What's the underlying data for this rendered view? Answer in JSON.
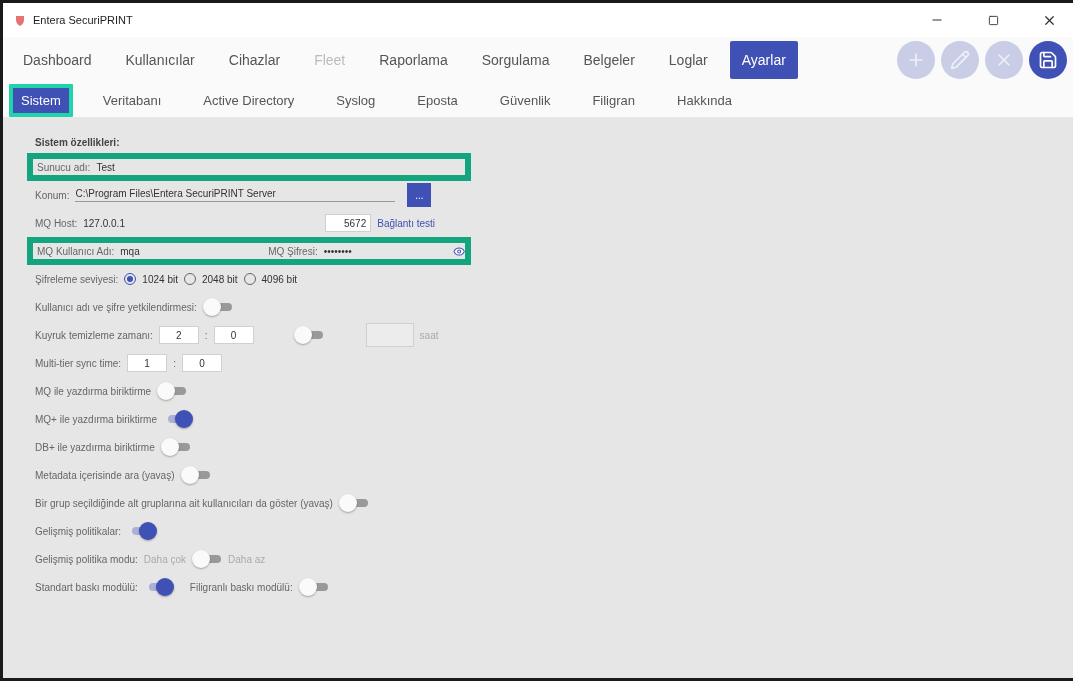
{
  "window": {
    "title": "Entera SecuriPRINT"
  },
  "nav": [
    {
      "label": "Dashboard",
      "selected": false,
      "disabled": false
    },
    {
      "label": "Kullanıcılar",
      "selected": false,
      "disabled": false
    },
    {
      "label": "Cihazlar",
      "selected": false,
      "disabled": false
    },
    {
      "label": "Fleet",
      "selected": false,
      "disabled": true
    },
    {
      "label": "Raporlama",
      "selected": false,
      "disabled": false
    },
    {
      "label": "Sorgulama",
      "selected": false,
      "disabled": false
    },
    {
      "label": "Belgeler",
      "selected": false,
      "disabled": false
    },
    {
      "label": "Loglar",
      "selected": false,
      "disabled": false
    },
    {
      "label": "Ayarlar",
      "selected": true,
      "disabled": false
    }
  ],
  "toolbar": [
    {
      "kind": "add",
      "disabled": true
    },
    {
      "kind": "edit",
      "disabled": true
    },
    {
      "kind": "delete",
      "disabled": true
    },
    {
      "kind": "save",
      "disabled": false
    }
  ],
  "sub_tabs": [
    {
      "label": "Sistem",
      "selected": true,
      "highlighted": true
    },
    {
      "label": "Veritabanı",
      "selected": false,
      "highlighted": false
    },
    {
      "label": "Active Directory",
      "selected": false,
      "highlighted": false
    },
    {
      "label": "Syslog",
      "selected": false,
      "highlighted": false
    },
    {
      "label": "Eposta",
      "selected": false,
      "highlighted": false
    },
    {
      "label": "Güvenlik",
      "selected": false,
      "highlighted": false
    },
    {
      "label": "Filigran",
      "selected": false,
      "highlighted": false
    },
    {
      "label": "Hakkında",
      "selected": false,
      "highlighted": false
    }
  ],
  "section_title": "Sistem özellikleri:",
  "rows": [
    {
      "kind": "text",
      "label": "Sunucu adı:",
      "value": "Test",
      "highlighted": true
    },
    {
      "kind": "path",
      "label": "Konum:",
      "value": "C:\\Program Files\\Entera SecuriPRINT Server",
      "button": "...",
      "highlighted": false
    },
    {
      "kind": "host",
      "label": "MQ Host:",
      "value": "127.0.0.1",
      "port": "5672",
      "link": "Bağlantı testi",
      "highlighted": false
    },
    {
      "kind": "credentials",
      "user_label": "MQ Kullanıcı Adı:",
      "user_value": "mqa",
      "password_label": "MQ Şifresi:",
      "password_value": "••••••••",
      "highlighted": true
    },
    {
      "kind": "radio",
      "label": "Şifreleme seviyesi:",
      "options": [
        {
          "label": "1024 bit",
          "selected": true
        },
        {
          "label": "2048 bit",
          "selected": false
        },
        {
          "label": "4096 bit",
          "selected": false
        }
      ]
    },
    {
      "kind": "toggle",
      "label": "Kullanıcı adı ve şifre yetkilendirmesi:",
      "on": false
    },
    {
      "kind": "time_toggle",
      "label": "Kuyruk temizleme zamanı:",
      "hours": "2",
      "separator": ":",
      "minutes": "0",
      "on": false,
      "unit": "saat"
    },
    {
      "kind": "time",
      "label": "Multi-tier sync time:",
      "hours": "1",
      "separator": ":",
      "minutes": "0"
    },
    {
      "kind": "toggle",
      "label": "MQ ile yazdırma biriktirme",
      "on": false
    },
    {
      "kind": "toggle",
      "label": "MQ+ ile yazdırma biriktirme",
      "on": true
    },
    {
      "kind": "toggle",
      "label": "DB+ ile yazdırma biriktirme",
      "on": false
    },
    {
      "kind": "toggle",
      "label": "Metadata içerisinde ara (yavaş)",
      "on": false
    },
    {
      "kind": "toggle",
      "label": "Bir grup seçildiğinde alt gruplarına ait kullanıcıları da göster (yavaş)",
      "on": false
    },
    {
      "kind": "toggle",
      "label": "Gelişmiş politikalar:",
      "on": true
    },
    {
      "kind": "mode",
      "label": "Gelişmiş politika modu:",
      "left": "Daha çok",
      "right": "Daha az",
      "on": false
    },
    {
      "kind": "dual",
      "items": [
        {
          "label": "Standart baskı modülü:",
          "on": true
        },
        {
          "label": "Filigranlı baskı modülü:",
          "on": false
        }
      ]
    }
  ]
}
